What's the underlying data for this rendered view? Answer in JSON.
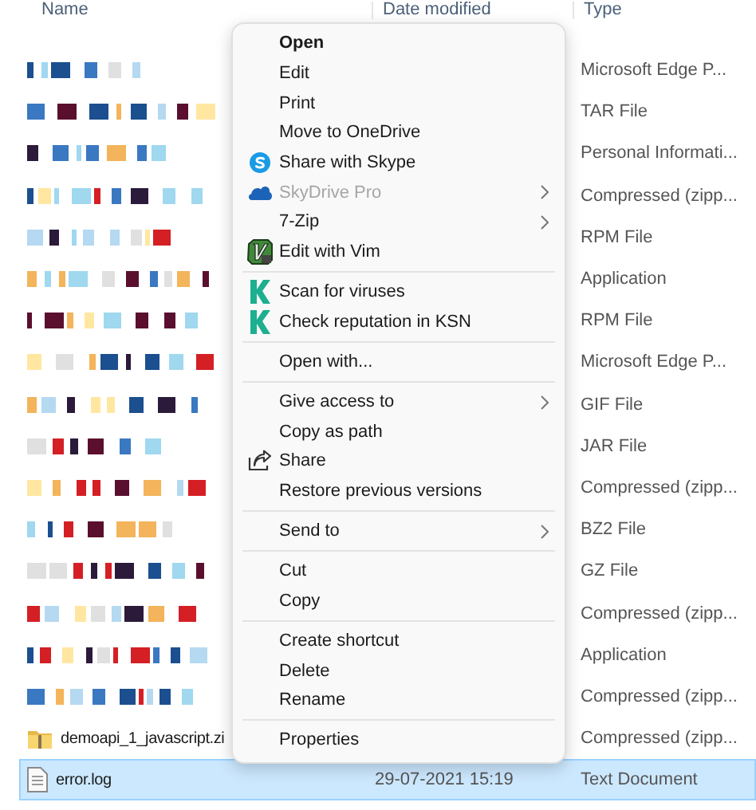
{
  "columns": [
    {
      "label": "Name"
    },
    {
      "label": "Date modified"
    },
    {
      "label": "Type"
    }
  ],
  "rows": [
    {
      "type": "Microsoft Edge P...",
      "selected": false
    },
    {
      "type": "TAR File",
      "selected": false
    },
    {
      "type": "Personal Informati...",
      "selected": false
    },
    {
      "type": "Compressed (zipp...",
      "selected": false
    },
    {
      "type": "RPM File",
      "selected": false
    },
    {
      "type": "Application",
      "selected": false
    },
    {
      "type": "RPM File",
      "selected": false
    },
    {
      "type": "Microsoft Edge P...",
      "selected": false
    },
    {
      "type": "GIF File",
      "selected": false
    },
    {
      "type": "JAR File",
      "selected": false
    },
    {
      "type": "Compressed (zipp...",
      "selected": false
    },
    {
      "type": "BZ2 File",
      "selected": false
    },
    {
      "type": "GZ File",
      "selected": false
    },
    {
      "type": "Compressed (zipp...",
      "selected": false
    },
    {
      "type": "Application",
      "selected": false
    },
    {
      "type": "Compressed (zipp...",
      "selected": false
    },
    {
      "name": "demoapi_1_javascript.zi",
      "kind": "zip",
      "type": "Compressed (zipp...",
      "selected": false
    },
    {
      "name": "error.log",
      "kind": "text",
      "date": "29-07-2021 15:19",
      "type": "Text Document",
      "selected": true
    }
  ],
  "context_menu": {
    "groups": [
      [
        {
          "label": "Open",
          "default": true,
          "disabled": false,
          "submenu": false
        },
        {
          "label": "Edit",
          "default": false,
          "disabled": false,
          "submenu": false
        },
        {
          "label": "Print",
          "default": false,
          "disabled": false,
          "submenu": false
        },
        {
          "label": "Move to OneDrive",
          "default": false,
          "disabled": false,
          "submenu": false
        },
        {
          "label": "Share with Skype",
          "kind": "skype",
          "default": false,
          "disabled": false,
          "submenu": false
        },
        {
          "label": "SkyDrive Pro",
          "kind": "cloud",
          "default": false,
          "disabled": true,
          "submenu": true
        },
        {
          "label": "7-Zip",
          "default": false,
          "disabled": false,
          "submenu": true
        },
        {
          "label": "Edit with Vim",
          "kind": "vim",
          "default": false,
          "disabled": false,
          "submenu": false
        }
      ],
      [
        {
          "label": "Scan for viruses",
          "kind": "scanner",
          "default": false,
          "disabled": false,
          "submenu": false
        },
        {
          "label": "Check reputation in KSN",
          "kind": "scanner",
          "default": false,
          "disabled": false,
          "submenu": false
        }
      ],
      [
        {
          "label": "Open with...",
          "default": false,
          "disabled": false,
          "submenu": false
        }
      ],
      [
        {
          "label": "Give access to",
          "default": false,
          "disabled": false,
          "submenu": true
        },
        {
          "label": "Copy as path",
          "default": false,
          "disabled": false,
          "submenu": false
        },
        {
          "label": "Share",
          "kind": "share",
          "default": false,
          "disabled": false,
          "submenu": false
        },
        {
          "label": "Restore previous versions",
          "default": false,
          "disabled": false,
          "submenu": false
        }
      ],
      [
        {
          "label": "Send to",
          "default": false,
          "disabled": false,
          "submenu": true
        }
      ],
      [
        {
          "label": "Cut",
          "default": false,
          "disabled": false,
          "submenu": false
        },
        {
          "label": "Copy",
          "default": false,
          "disabled": false,
          "submenu": false
        }
      ],
      [
        {
          "label": "Create shortcut",
          "default": false,
          "disabled": false,
          "submenu": false
        },
        {
          "label": "Delete",
          "default": false,
          "disabled": false,
          "submenu": false
        },
        {
          "label": "Rename",
          "default": false,
          "disabled": false,
          "submenu": false
        }
      ],
      [
        {
          "label": "Properties",
          "default": false,
          "disabled": false,
          "submenu": false
        }
      ]
    ]
  }
}
